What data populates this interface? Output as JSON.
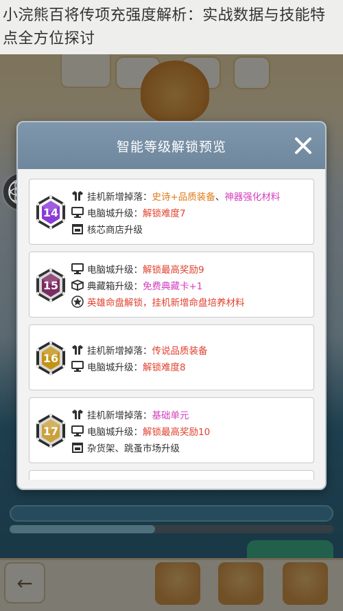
{
  "caption": {
    "text": "小浣熊百将传项充强度解析：实战数据与技能特点全方位探讨"
  },
  "modal": {
    "title": "智能等级解锁预览",
    "close_icon": "close-icon"
  },
  "colors": {
    "level14": "#8b3bd8",
    "level15": "#7e2a63",
    "level16": "#c39315",
    "level17": "#caa13c",
    "orange": "#e07b1a",
    "red": "#e0412e",
    "pink": "#d33fbe",
    "header": "#7891a8"
  },
  "levels": [
    {
      "level": "14",
      "rows": [
        {
          "icon": "hanger-icon",
          "label": "挂机新增掉落：",
          "parts": [
            {
              "text": "史诗+品质装备",
              "color": "orange"
            },
            {
              "text": "、",
              "color": "gray"
            },
            {
              "text": "神器强化材料",
              "color": "pink"
            }
          ]
        },
        {
          "icon": "monitor-icon",
          "label": "电脑城升级：",
          "parts": [
            {
              "text": "解锁难度7",
              "color": "red"
            }
          ]
        },
        {
          "icon": "shop-icon",
          "label": "核芯商店升级",
          "parts": []
        }
      ]
    },
    {
      "level": "15",
      "rows": [
        {
          "icon": "monitor-icon",
          "label": "电脑城升级：",
          "parts": [
            {
              "text": "解锁最高奖励9",
              "color": "red"
            }
          ]
        },
        {
          "icon": "box-icon",
          "label": "典藏箱升级：",
          "parts": [
            {
              "text": "免费典藏卡+1",
              "color": "pink"
            }
          ]
        },
        {
          "icon": "star-icon",
          "label": "",
          "parts": [
            {
              "text": "英雄命盘解锁，挂机新增命盘培养材料",
              "color": "red"
            }
          ]
        }
      ]
    },
    {
      "level": "16",
      "rows": [
        {
          "icon": "hanger-icon",
          "label": "挂机新增掉落：",
          "parts": [
            {
              "text": "传说品质装备",
              "color": "red"
            }
          ]
        },
        {
          "icon": "monitor-icon",
          "label": "电脑城升级：",
          "parts": [
            {
              "text": "解锁难度8",
              "color": "red"
            }
          ]
        }
      ]
    },
    {
      "level": "17",
      "rows": [
        {
          "icon": "hanger-icon",
          "label": "挂机新增掉落：",
          "parts": [
            {
              "text": "基础单元",
              "color": "pink"
            }
          ]
        },
        {
          "icon": "monitor-icon",
          "label": "电脑城升级：",
          "parts": [
            {
              "text": "解锁最高奖励10",
              "color": "red"
            }
          ]
        },
        {
          "icon": "shop-icon",
          "label": "杂货架、跳蚤市场升级",
          "parts": []
        }
      ]
    }
  ],
  "background": {
    "progress_fraction": 0.45
  }
}
